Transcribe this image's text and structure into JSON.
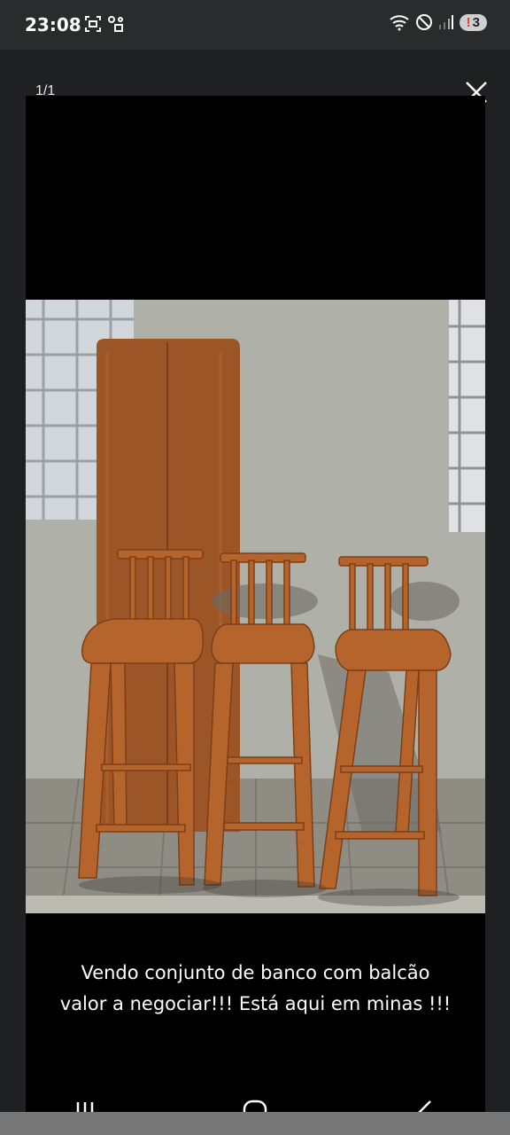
{
  "status_bar": {
    "time": "23:08",
    "notification_count": "3",
    "notification_mark": "!"
  },
  "viewer": {
    "counter": "1/1",
    "caption_line1": "Vendo conjunto  de banco com balcão",
    "caption_line2": "valor a negociar!!! Está aqui em minas !!!"
  },
  "icons": {
    "close": "close-icon",
    "recents": "recent-apps-icon",
    "home": "home-icon",
    "back": "back-icon"
  },
  "colors": {
    "background": "#1f2022",
    "photo_frame": "#000000",
    "wood": "#b5652b"
  }
}
